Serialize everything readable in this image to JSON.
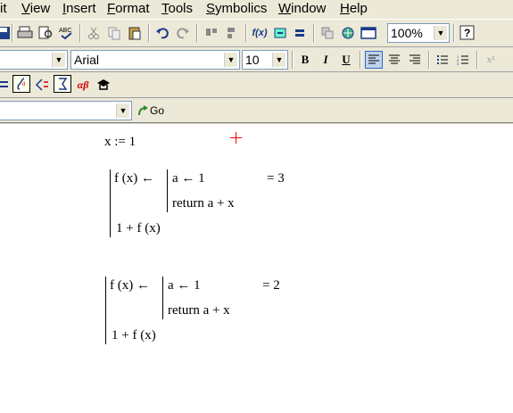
{
  "menu": [
    "it",
    "View",
    "Insert",
    "Format",
    "Tools",
    "Symbolics",
    "Window",
    "Help"
  ],
  "menu_underline": [
    "",
    "V",
    "I",
    "F",
    "T",
    "S",
    "W",
    "H"
  ],
  "toolbar": {
    "zoom": "100%",
    "func_label": "f(x)"
  },
  "format_bar": {
    "font": "Arial",
    "size": "10",
    "bold": "B",
    "italic": "I",
    "underline": "U",
    "superscript": "x²"
  },
  "math_bar": {
    "greek": "αβ"
  },
  "resource_bar": {
    "go": "Go"
  },
  "worksheet": {
    "def": "x := 1",
    "block1": {
      "line1": "f (x) ←",
      "inner1": "a ← 1",
      "inner2": "return  a + x",
      "result": "= 3",
      "line2": "1 + f (x)"
    },
    "block2": {
      "line1": "f (x) ←",
      "inner1": "a ← 1",
      "inner2": "return  a + x",
      "result": "= 2",
      "line2": "1 + f (x)"
    }
  }
}
